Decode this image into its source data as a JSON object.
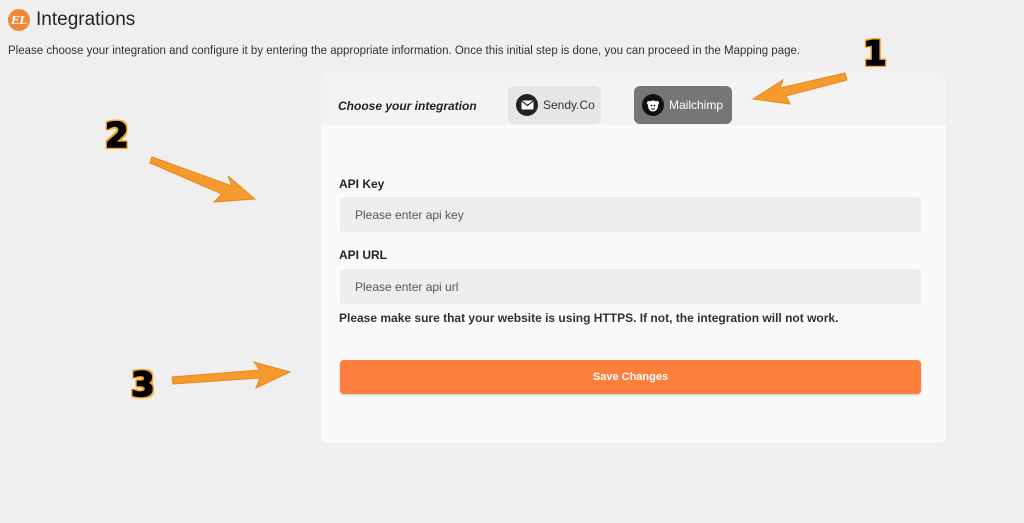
{
  "header": {
    "logo_text": "EL",
    "title": "Integrations",
    "description": "Please choose your integration and configure it by entering the appropriate information. Once this initial step is done, you can proceed in the Mapping page."
  },
  "integrations": {
    "label": "Choose your integration",
    "options": [
      {
        "label": "Sendy.Co",
        "icon": "envelope-icon",
        "selected": false
      },
      {
        "label": "Mailchimp",
        "icon": "mailchimp-icon",
        "selected": true
      }
    ]
  },
  "form": {
    "api_key_label": "API Key",
    "api_key_placeholder": "Please enter api key",
    "api_url_label": "API URL",
    "api_url_placeholder": "Please enter api url",
    "notice": "Please make sure that your website is using HTTPS. If not, the integration will not work.",
    "save_label": "Save Changes"
  },
  "annotations": [
    "1",
    "2",
    "3"
  ],
  "colors": {
    "accent": "#fd7e3d",
    "annotation_orange": "#f5a623",
    "selected_integration_bg": "#767676"
  }
}
